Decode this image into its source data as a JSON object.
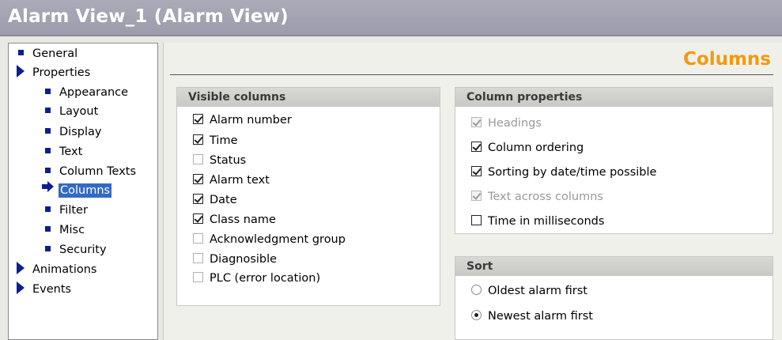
{
  "window": {
    "title": "Alarm View_1 (Alarm View)"
  },
  "nav": {
    "items": [
      {
        "label": "General",
        "icon": "square-bullet-icon"
      },
      {
        "label": "Properties",
        "icon": "expand-triangle-icon"
      },
      {
        "label": "Appearance",
        "icon": "square-bullet-icon"
      },
      {
        "label": "Layout",
        "icon": "square-bullet-icon"
      },
      {
        "label": "Display",
        "icon": "square-bullet-icon"
      },
      {
        "label": "Text",
        "icon": "square-bullet-icon"
      },
      {
        "label": "Column Texts",
        "icon": "square-bullet-icon"
      },
      {
        "label": "Columns",
        "icon": "selected-arrow-icon",
        "selected": true
      },
      {
        "label": "Filter",
        "icon": "square-bullet-icon"
      },
      {
        "label": "Misc",
        "icon": "square-bullet-icon"
      },
      {
        "label": "Security",
        "icon": "square-bullet-icon"
      },
      {
        "label": "Animations",
        "icon": "expand-triangle-icon"
      },
      {
        "label": "Events",
        "icon": "expand-triangle-icon"
      }
    ]
  },
  "page": {
    "title": "Columns"
  },
  "visible_columns": {
    "heading": "Visible columns",
    "items": [
      {
        "label": "Alarm number",
        "checked": true
      },
      {
        "label": "Time",
        "checked": true
      },
      {
        "label": "Status",
        "checked": false
      },
      {
        "label": "Alarm text",
        "checked": true
      },
      {
        "label": "Date",
        "checked": true
      },
      {
        "label": "Class name",
        "checked": true
      },
      {
        "label": "Acknowledgment group",
        "checked": false
      },
      {
        "label": "Diagnosible",
        "checked": false
      },
      {
        "label": "PLC (error location)",
        "checked": false
      }
    ]
  },
  "column_properties": {
    "heading": "Column properties",
    "items": [
      {
        "label": "Headings",
        "checked": true,
        "disabled": true
      },
      {
        "label": "Column ordering",
        "checked": true,
        "disabled": false
      },
      {
        "label": "Sorting by date/time possible",
        "checked": true,
        "disabled": false
      },
      {
        "label": "Text across columns",
        "checked": true,
        "disabled": true
      },
      {
        "label": "Time in milliseconds",
        "checked": false,
        "disabled": false
      }
    ]
  },
  "sort": {
    "heading": "Sort",
    "options": [
      {
        "label": "Oldest alarm first",
        "selected": false
      },
      {
        "label": "Newest alarm first",
        "selected": true
      }
    ]
  },
  "colors": {
    "title_bar": "#9c9cac",
    "accent_orange": "#f29a0b",
    "nav_bullet": "#0c1e92",
    "selection": "#316ac5"
  }
}
